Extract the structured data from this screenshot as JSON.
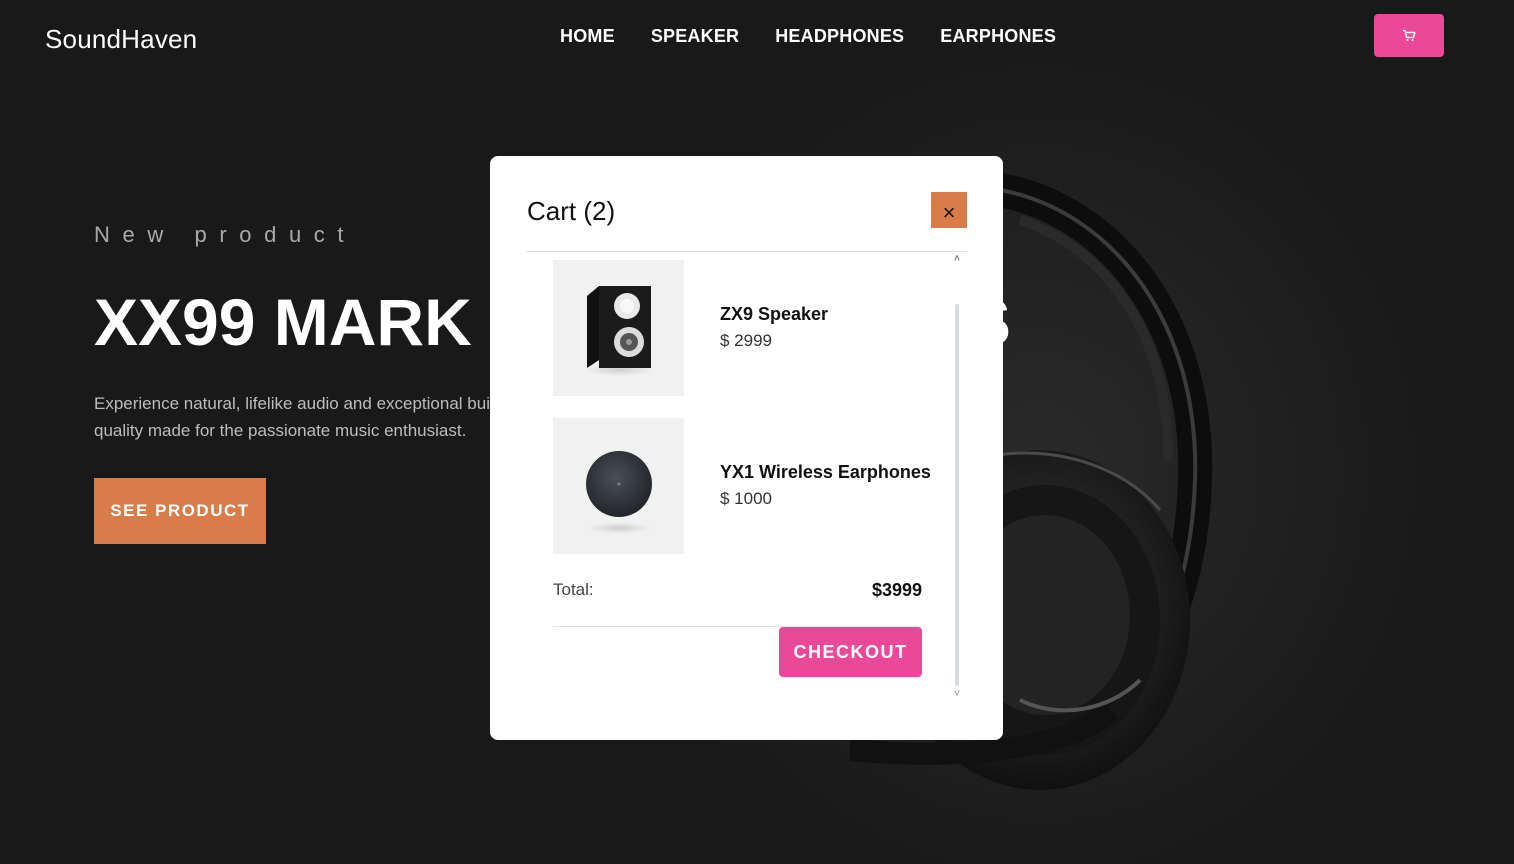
{
  "header": {
    "logo": "SoundHaven",
    "nav": [
      "HOME",
      "SPEAKER",
      "HEADPHONES",
      "EARPHONES"
    ],
    "cart_icon": "cart-icon"
  },
  "hero": {
    "eyebrow": "New product",
    "title": "XX99 MARK II HEADPHONES",
    "description": "Experience natural, lifelike audio and exceptional build quality made for the passionate music enthusiast.",
    "cta_label": "SEE PRODUCT"
  },
  "cart": {
    "title": "Cart (2)",
    "close_label": "×",
    "items": [
      {
        "name": "ZX9 Speaker",
        "price": "$ 2999",
        "image": "speaker-image"
      },
      {
        "name": "YX1 Wireless Earphones",
        "price": "$ 1000",
        "image": "earphones-image"
      }
    ],
    "total_label": "Total:",
    "total_value": "$3999",
    "checkout_label": "CHECKOUT"
  },
  "colors": {
    "accent_orange": "#d87d4a",
    "accent_pink": "#ec4899",
    "background": "#191919"
  }
}
